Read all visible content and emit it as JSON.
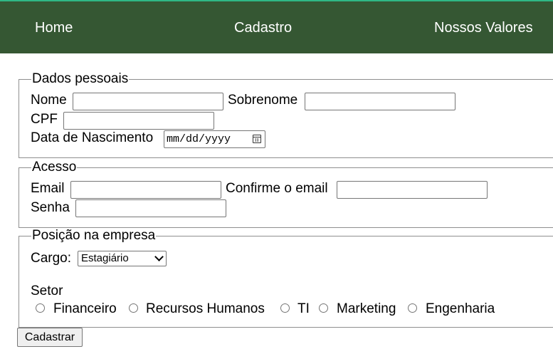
{
  "nav": {
    "items": [
      {
        "label": "Home"
      },
      {
        "label": "Cadastro"
      },
      {
        "label": "Nossos Valores"
      }
    ]
  },
  "dados": {
    "legend": "Dados pessoais",
    "nome_label": "Nome",
    "sobrenome_label": "Sobrenome",
    "cpf_label": "CPF",
    "nascimento_label": "Data de Nascimento",
    "nascimento_placeholder": "mm/dd/yyyy"
  },
  "acesso": {
    "legend": "Acesso",
    "email_label": "Email",
    "confirme_label": "Confirme o email",
    "senha_label": "Senha"
  },
  "posicao": {
    "legend": "Posição na empresa",
    "cargo_label": "Cargo:",
    "cargo_selected": "Estagiário",
    "setor_label": "Setor",
    "setores": [
      "Financeiro",
      "Recursos Humanos",
      "TI",
      "Marketing",
      "Engenharia"
    ]
  },
  "submit_label": "Cadastrar",
  "colors": {
    "nav_bg": "#355733",
    "top_accent": "#2fb886"
  }
}
